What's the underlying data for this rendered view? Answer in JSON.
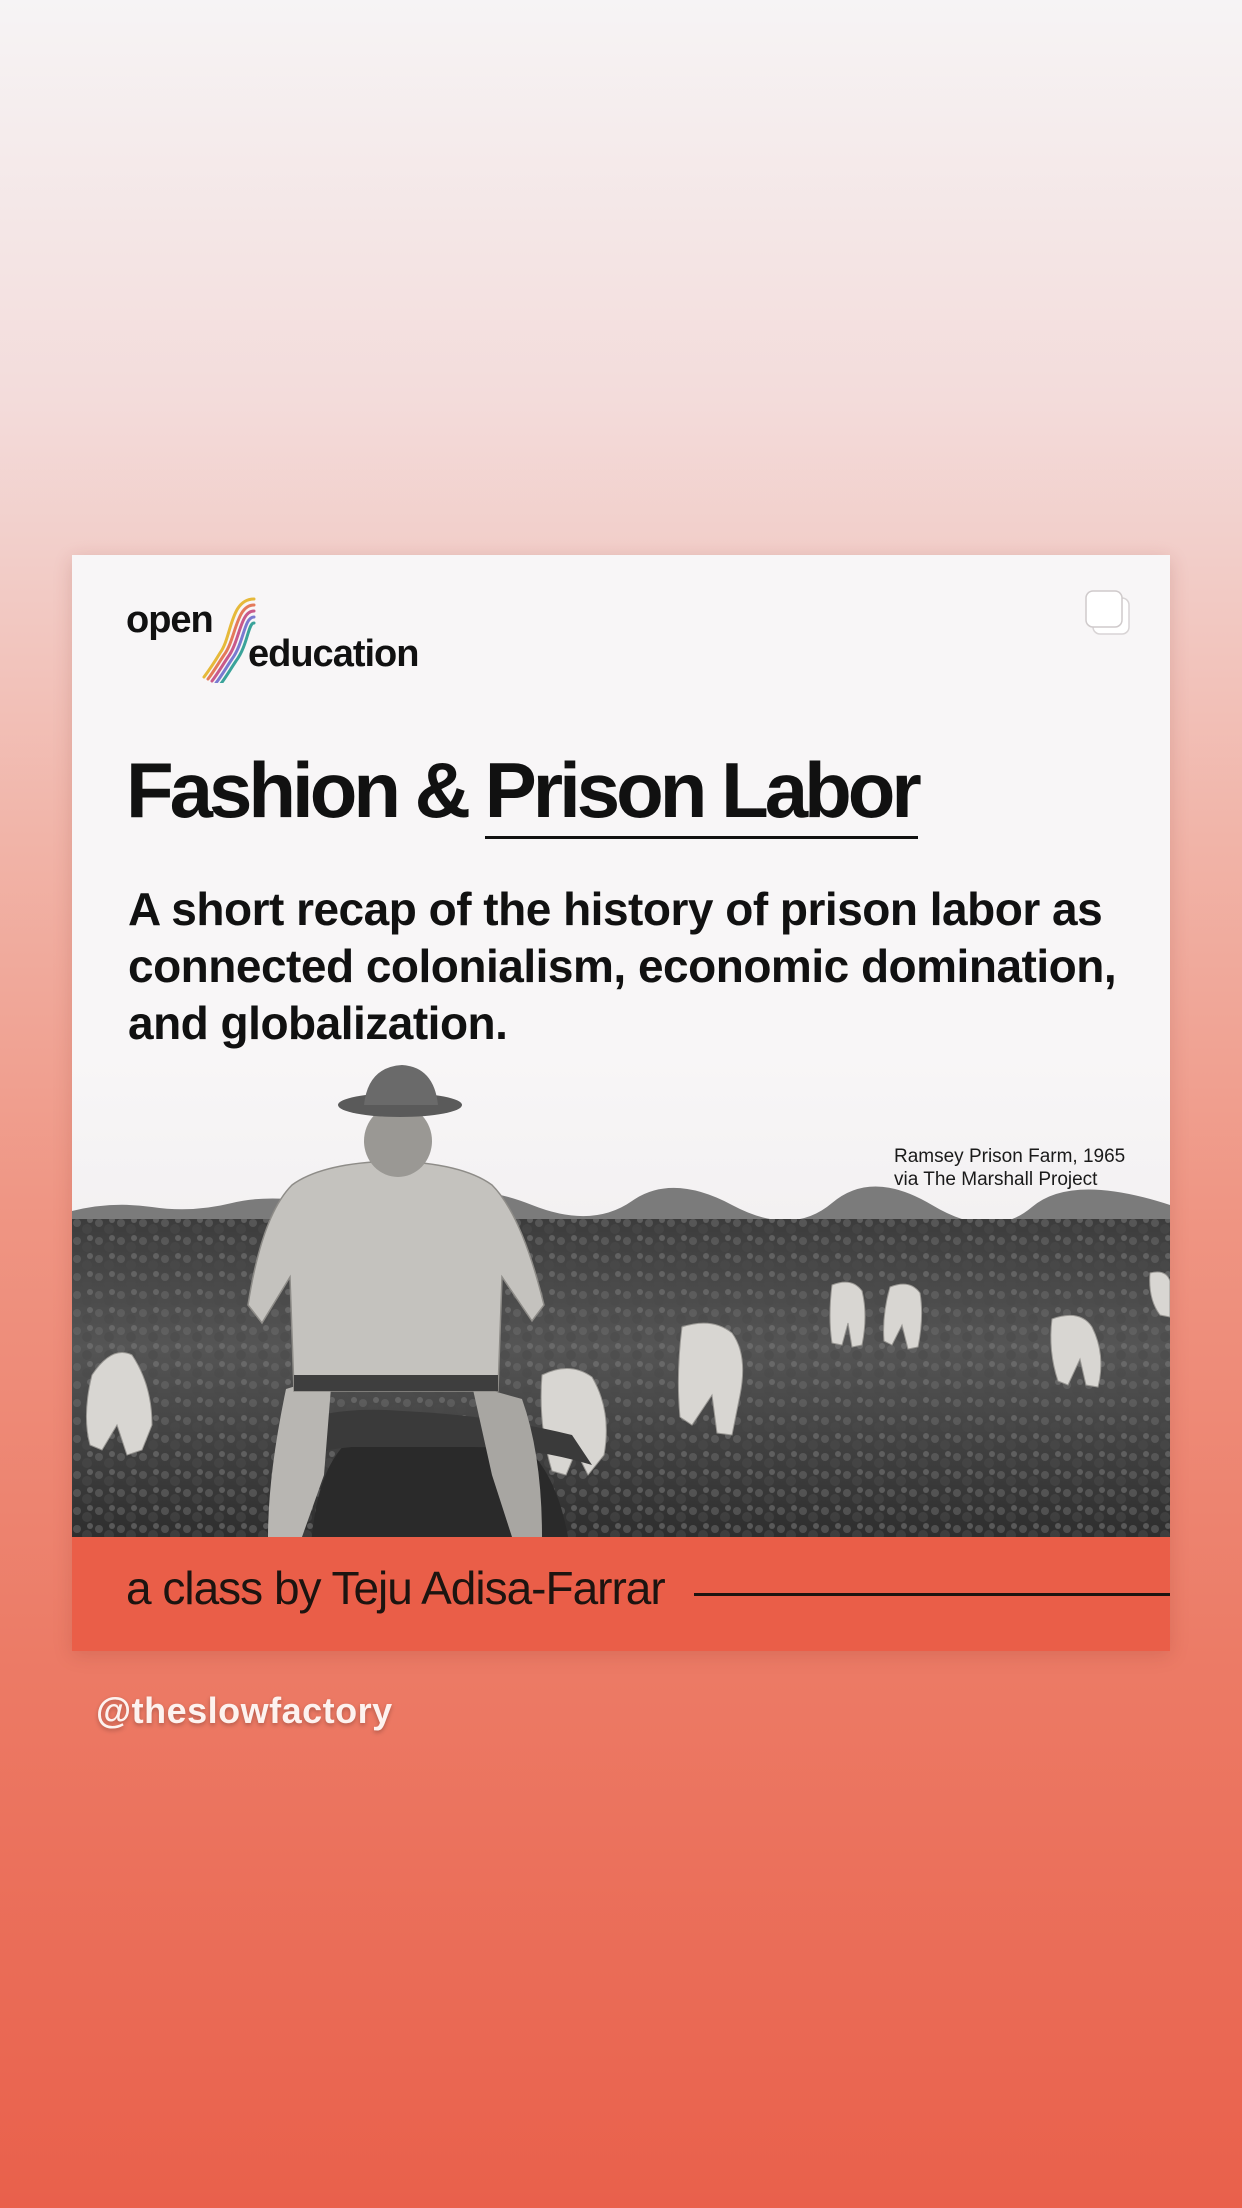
{
  "story": {
    "logo": {
      "word1": "open",
      "word2": "education"
    },
    "title": {
      "part1": "Fashion & ",
      "part2": "Prison Labor"
    },
    "subtitle": "A short recap of the history of prison labor as connected colonialism, economic domination, and globalization.",
    "photo_caption": {
      "line1": "Ramsey Prison Farm, 1965",
      "line2": "via The Marshall Project"
    },
    "band_text": "a class by Teju Adisa-Farrar",
    "handle": "@theslowfactory"
  },
  "colors": {
    "accent": "#ea5e48",
    "text": "#111111",
    "card": "#f8f6f7"
  },
  "icons": {
    "corner": "copy-icon"
  }
}
